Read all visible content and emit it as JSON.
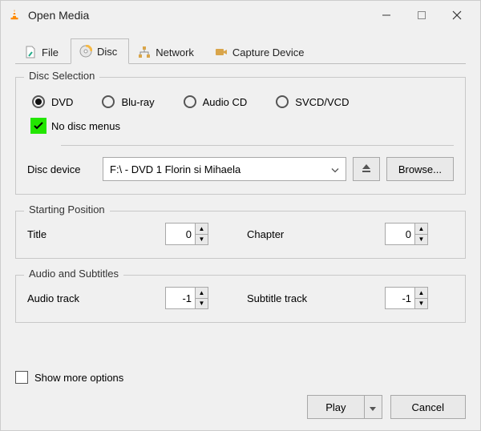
{
  "window": {
    "title": "Open Media"
  },
  "tabs": {
    "file": "File",
    "disc": "Disc",
    "network": "Network",
    "capture": "Capture Device",
    "active": "disc"
  },
  "disc_selection": {
    "legend": "Disc Selection",
    "options": {
      "dvd": "DVD",
      "bluray": "Blu-ray",
      "audiocd": "Audio CD",
      "svcd": "SVCD/VCD"
    },
    "selected": "dvd",
    "no_menus_label": "No disc menus",
    "no_menus_checked": true,
    "device_label": "Disc device",
    "device_value": "F:\\ - DVD 1 Florin si Mihaela",
    "browse_label": "Browse..."
  },
  "starting_position": {
    "legend": "Starting Position",
    "title_label": "Title",
    "title_value": "0",
    "chapter_label": "Chapter",
    "chapter_value": "0"
  },
  "audio_subtitles": {
    "legend": "Audio and Subtitles",
    "audio_label": "Audio track",
    "audio_value": "-1",
    "subtitle_label": "Subtitle track",
    "subtitle_value": "-1"
  },
  "footer": {
    "show_more_label": "Show more options",
    "show_more_checked": false,
    "play_label": "Play",
    "cancel_label": "Cancel"
  }
}
